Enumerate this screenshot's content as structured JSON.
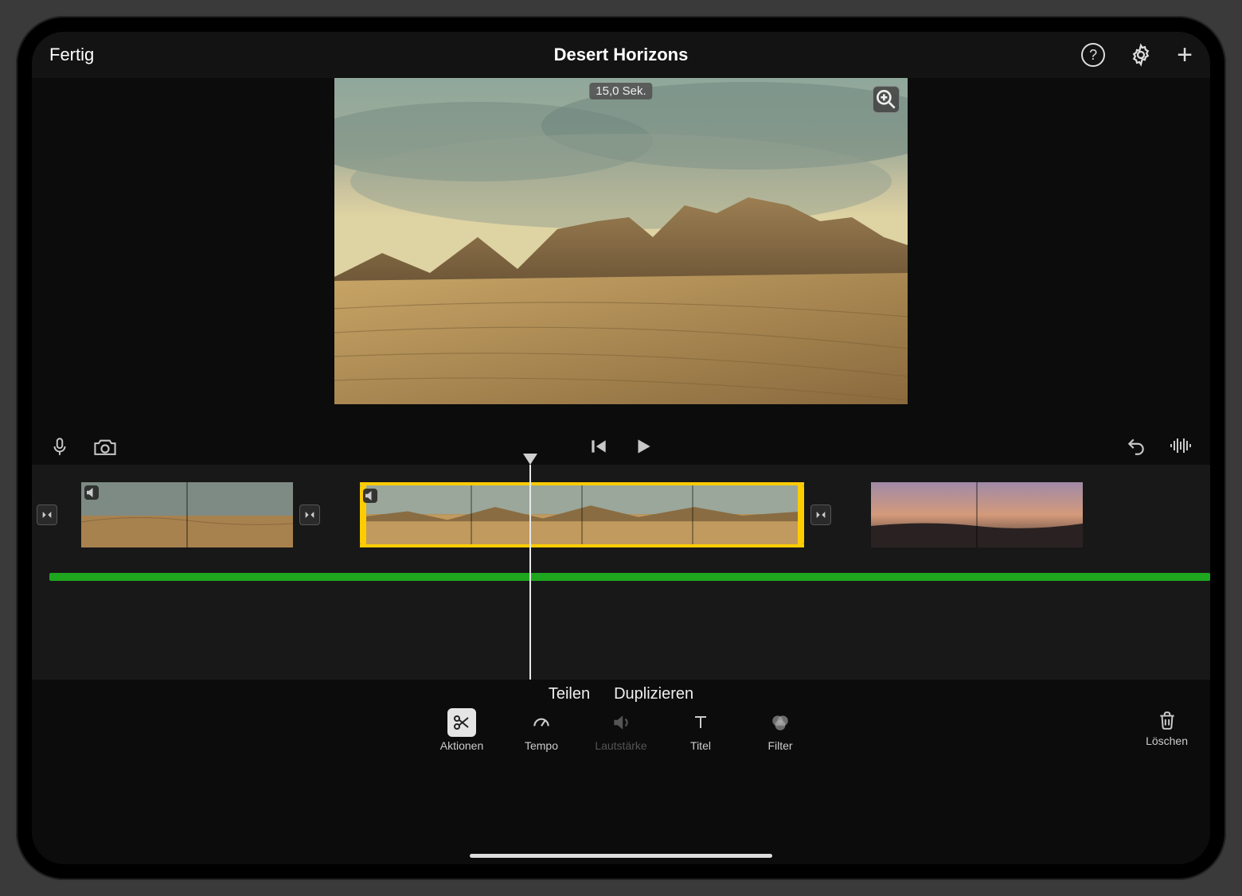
{
  "topbar": {
    "done": "Fertig",
    "title": "Desert Horizons"
  },
  "preview": {
    "duration_badge": "15,0 Sek."
  },
  "actions": {
    "split": "Teilen",
    "duplicate": "Duplizieren"
  },
  "tray": {
    "aktionen": "Aktionen",
    "tempo": "Tempo",
    "lautstaerke": "Lautstärke",
    "titel": "Titel",
    "filter": "Filter",
    "loeschen": "Löschen"
  },
  "icons": {
    "help": "help-icon",
    "settings": "gear-icon",
    "add": "plus-icon",
    "mic": "microphone-icon",
    "camera": "camera-icon",
    "prev": "skip-back-icon",
    "play": "play-icon",
    "undo": "undo-icon",
    "audio": "waveform-icon",
    "zoom": "magnify-plus-icon",
    "transition": "transition-icon",
    "sound_chip": "speaker-icon",
    "scissors": "scissors-icon",
    "speedometer": "speedometer-icon",
    "volume": "volume-icon",
    "text": "text-icon",
    "filter_circles": "filter-circles-icon",
    "trash": "trash-icon"
  }
}
